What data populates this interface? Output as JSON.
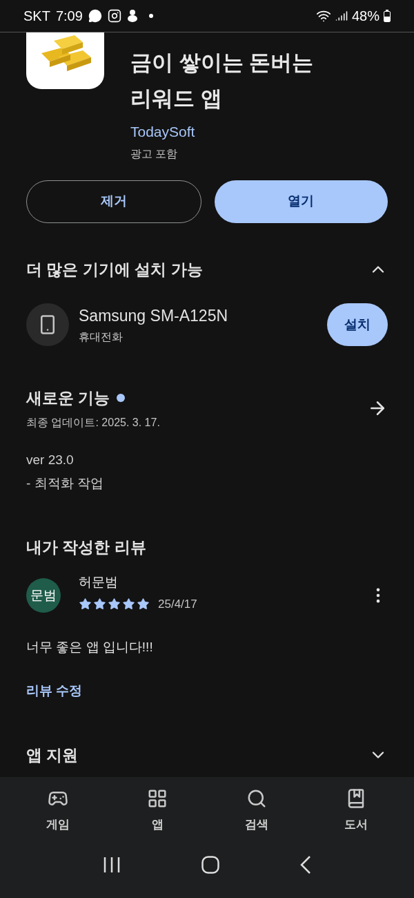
{
  "status_bar": {
    "carrier": "SKT",
    "time": "7:09",
    "battery": "48%"
  },
  "app": {
    "title_lines": [
      "금이 쌓이는 돈버는",
      "리워드 앱"
    ],
    "developer": "TodaySoft",
    "ads_note": "광고 포함"
  },
  "actions": [
    {
      "label": "제거",
      "kind": "outline"
    },
    {
      "label": "열기",
      "kind": "filled"
    }
  ],
  "more_devices": {
    "title": "더 많은 기기에 설치 가능",
    "expanded": true,
    "devices": [
      {
        "name": "Samsung SM-A125N",
        "type": "휴대전화",
        "button": "설치"
      }
    ]
  },
  "whats_new": {
    "title": "새로운 기능",
    "new_indicator": true,
    "updated": "최종 업데이트: 2025. 3. 17.",
    "notes": [
      "ver 23.0",
      "- 최적화 작업"
    ]
  },
  "my_review": {
    "title": "내가 작성한 리뷰",
    "avatar": "문범",
    "author": "허문범",
    "stars": 5,
    "date": "25/4/17",
    "text": "너무 좋은 앱 입니다!!!",
    "edit_link": "리뷰 수정"
  },
  "app_support": {
    "title": "앱 지원",
    "expanded": false
  },
  "bottom_nav": [
    {
      "label": "게임",
      "kind": "games"
    },
    {
      "label": "앱",
      "kind": "apps"
    },
    {
      "label": "검색",
      "kind": "search"
    },
    {
      "label": "도서",
      "kind": "books"
    }
  ]
}
